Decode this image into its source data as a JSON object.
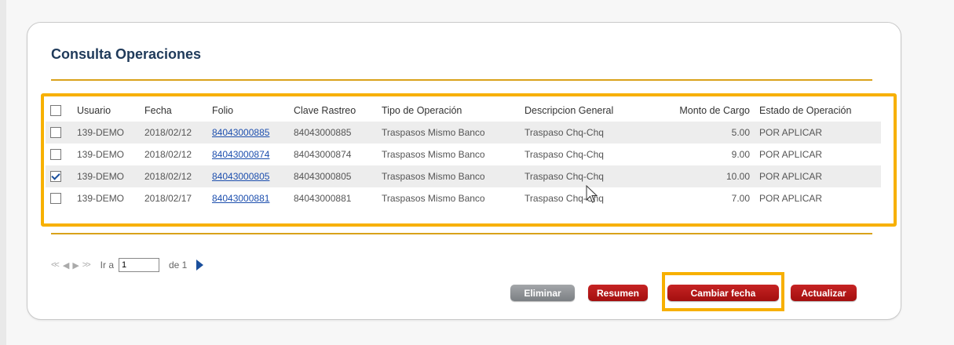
{
  "page": {
    "title": "Consulta Operaciones"
  },
  "table": {
    "headers": [
      "Usuario",
      "Fecha",
      "Folio",
      "Clave Rastreo",
      "Tipo de Operación",
      "Descripcion General",
      "Monto de Cargo",
      "Estado de Operación"
    ],
    "rows": [
      {
        "checked": false,
        "usuario": "139-DEMO",
        "fecha": "2018/02/12",
        "folio": "84043000885",
        "clave": "84043000885",
        "tipo": "Traspasos Mismo Banco",
        "descripcion": "Traspaso Chq-Chq",
        "monto": "5.00",
        "estado": "POR APLICAR"
      },
      {
        "checked": false,
        "usuario": "139-DEMO",
        "fecha": "2018/02/12",
        "folio": "84043000874",
        "clave": "84043000874",
        "tipo": "Traspasos Mismo Banco",
        "descripcion": "Traspaso Chq-Chq",
        "monto": "9.00",
        "estado": "POR APLICAR"
      },
      {
        "checked": true,
        "usuario": "139-DEMO",
        "fecha": "2018/02/12",
        "folio": "84043000805",
        "clave": "84043000805",
        "tipo": "Traspasos Mismo Banco",
        "descripcion": "Traspaso Chq-Chq",
        "monto": "10.00",
        "estado": "POR APLICAR"
      },
      {
        "checked": false,
        "usuario": "139-DEMO",
        "fecha": "2018/02/17",
        "folio": "84043000881",
        "clave": "84043000881",
        "tipo": "Traspasos Mismo Banco",
        "descripcion": "Traspaso Chq-Chq",
        "monto": "7.00",
        "estado": "POR APLICAR"
      }
    ]
  },
  "pager": {
    "ir_a_label": "Ir a",
    "page_value": "1",
    "de_label": "de 1"
  },
  "buttons": {
    "eliminar": "Eliminar",
    "resumen": "Resumen",
    "cambiar_fecha": "Cambiar fecha",
    "actualizar": "Actualizar"
  },
  "colors": {
    "accent_rule": "#d9a21b",
    "highlight": "#f7b000",
    "button_red": "#b01818",
    "link": "#1d4fae"
  },
  "icons": [
    "checkbox-icon",
    "first-page-icon",
    "prev-page-icon",
    "next-page-icon",
    "last-page-icon",
    "next-arrow-icon",
    "mouse-cursor-icon"
  ]
}
